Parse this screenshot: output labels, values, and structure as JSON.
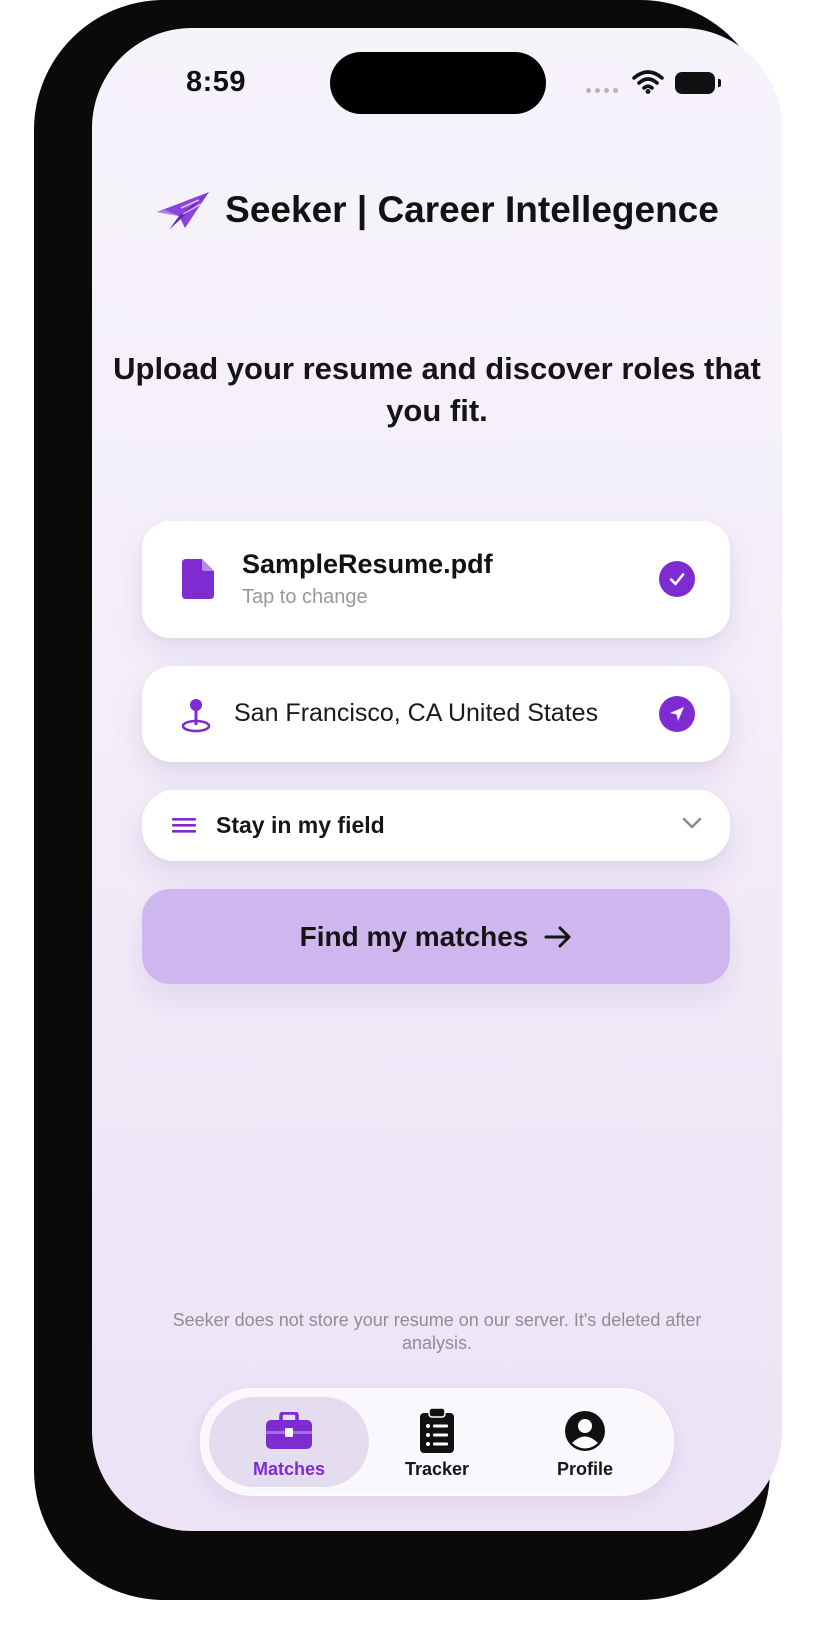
{
  "status_bar": {
    "time": "8:59"
  },
  "header": {
    "brand_title": "Seeker | Career Intellegence",
    "logo_icon": "paper-plane-icon"
  },
  "main": {
    "headline": "Upload your resume and discover roles that you fit.",
    "resume_card": {
      "file_name": "SampleResume.pdf",
      "subtitle": "Tap to change",
      "icon": "document-icon",
      "status_icon": "checkmark-circle-icon"
    },
    "location_card": {
      "value": "San Francisco, CA United States",
      "icon": "location-pin-icon",
      "action_icon": "navigation-arrow-icon"
    },
    "field_select": {
      "selected": "Stay in my field",
      "icon": "lines-icon",
      "chevron_icon": "chevron-down-icon"
    },
    "cta": {
      "label": "Find my matches",
      "icon": "arrow-right-icon"
    },
    "disclaimer": "Seeker does not store your resume on our server. It's deleted after analysis."
  },
  "tab_bar": {
    "tabs": [
      {
        "label": "Matches",
        "icon": "briefcase-icon",
        "active": true
      },
      {
        "label": "Tracker",
        "icon": "clipboard-icon",
        "active": false
      },
      {
        "label": "Profile",
        "icon": "person-circle-icon",
        "active": false
      }
    ]
  },
  "colors": {
    "accent": "#7f2bd2",
    "cta_background": "#ceb7ee",
    "screen_background": "#f3eef9"
  }
}
